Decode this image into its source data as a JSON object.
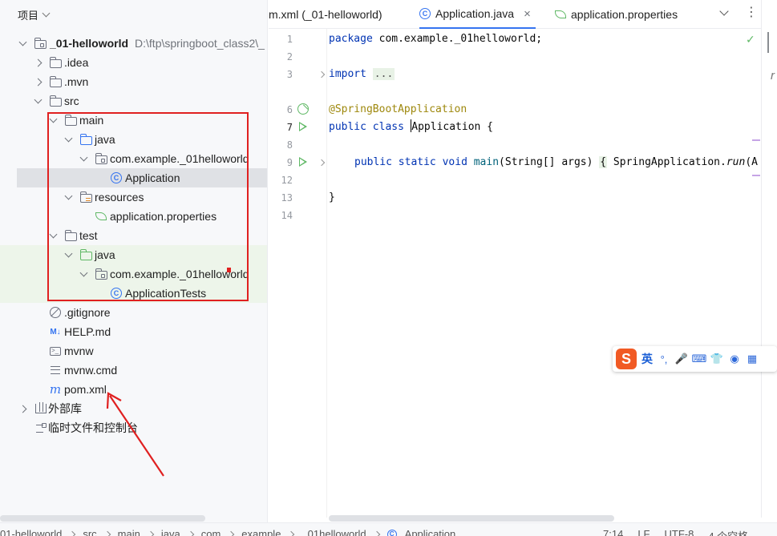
{
  "project_panel": {
    "title": "项目",
    "tree": [
      {
        "label": "_01-helloworld",
        "path": "D:\\ftp\\springboot_class2\\_"
      },
      {
        "label": ".idea"
      },
      {
        "label": ".mvn"
      },
      {
        "label": "src"
      },
      {
        "label": "main"
      },
      {
        "label": "java"
      },
      {
        "label": "com.example._01helloworld"
      },
      {
        "label": "Application"
      },
      {
        "label": "resources"
      },
      {
        "label": "application.properties"
      },
      {
        "label": "test"
      },
      {
        "label": "java"
      },
      {
        "label": "com.example._01helloworld"
      },
      {
        "label": "ApplicationTests"
      },
      {
        "label": ".gitignore"
      },
      {
        "label": "HELP.md",
        "icon_text": "M↓"
      },
      {
        "label": "mvnw",
        "icon_text": ">_"
      },
      {
        "label": "mvnw.cmd"
      },
      {
        "label": "pom.xml",
        "icon_text": "m"
      },
      {
        "label": "外部库"
      },
      {
        "label": "临时文件和控制台"
      }
    ]
  },
  "editor": {
    "tabs": [
      {
        "label": "m.xml (_01-helloworld)"
      },
      {
        "label": "Application.java",
        "close": "×"
      },
      {
        "label": "application.properties"
      }
    ],
    "menu_glyph": "⋮",
    "check_glyph": "✓",
    "line_numbers": [
      "1",
      "2",
      "3",
      "6",
      "7",
      "8",
      "9",
      "12",
      "13",
      "14"
    ],
    "code": {
      "l1_kw": "package",
      "l1_rest": " com.example._01helloworld;",
      "l3_kw": "import",
      "l3_fold": "...",
      "l6_ann": "@SpringBootApplication",
      "l7_kw1": "public",
      "l7_kw2": "class",
      "l7_name": "Application",
      "l7_brace": " {",
      "l9_kw1": "public",
      "l9_kw2": "static",
      "l9_kw3": "void",
      "l9_method": "main",
      "l9_params": "(String[] args) ",
      "l9_brace": "{",
      "l9_call": " SpringApplication.",
      "l9_run": "run",
      "l9_tail": "(A",
      "l13_brace": "}"
    },
    "right_glyph": "r"
  },
  "ime": {
    "logo": "S",
    "lang": "英",
    "punct": "°,",
    "mic": "🎤",
    "keyboard": "⌨",
    "skin": "👕",
    "robot": "◉",
    "grid": "▦"
  },
  "status_bar": {
    "crumbs": [
      "01-helloworld",
      "src",
      "main",
      "java",
      "com",
      "example",
      "_01helloworld",
      "Application"
    ],
    "position": "7:14",
    "line_ending": "LF",
    "encoding": "UTF-8",
    "indent": "4 个空格"
  },
  "colors": {
    "accent": "#3574f0",
    "annotation": "#e02020",
    "run_green": "#5fb865"
  }
}
